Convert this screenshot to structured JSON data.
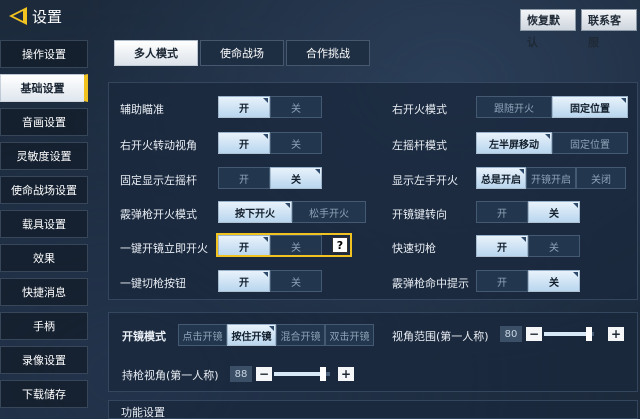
{
  "header": {
    "title": "设置",
    "restore_label": "恢复默认",
    "service_label": "联系客服"
  },
  "sidebar": {
    "items": [
      {
        "label": "操作设置"
      },
      {
        "label": "基础设置",
        "active": true
      },
      {
        "label": "音画设置"
      },
      {
        "label": "灵敏度设置"
      },
      {
        "label": "使命战场设置"
      },
      {
        "label": "载具设置"
      },
      {
        "label": "效果"
      },
      {
        "label": "快捷消息"
      },
      {
        "label": "手柄"
      },
      {
        "label": "录像设置"
      },
      {
        "label": "下载储存"
      }
    ]
  },
  "tabs": [
    {
      "label": "多人模式",
      "active": true
    },
    {
      "label": "使命战场"
    },
    {
      "label": "合作挑战"
    }
  ],
  "settings": {
    "aim_assist": {
      "label": "辅助瞄准",
      "options": [
        "开",
        "关"
      ],
      "selected": 0
    },
    "right_fire_turn": {
      "label": "右开火转动视角",
      "options": [
        "开",
        "关"
      ],
      "selected": 0
    },
    "fixed_left_stick": {
      "label": "固定显示左摇杆",
      "options": [
        "开",
        "关"
      ],
      "selected": 1
    },
    "shotgun_fire_mode": {
      "label": "霰弹枪开火模式",
      "options": [
        "按下开火",
        "松手开火"
      ],
      "selected": 0
    },
    "scope_fire": {
      "label": "一键开镜立即开火",
      "options": [
        "开",
        "关"
      ],
      "selected": 0,
      "help": "?"
    },
    "switch_gun_button": {
      "label": "一键切枪按钮",
      "options": [
        "开",
        "关"
      ],
      "selected": 0
    },
    "right_fire_mode": {
      "label": "右开火模式",
      "options": [
        "跟随开火",
        "固定位置"
      ],
      "selected": 1
    },
    "left_stick_mode": {
      "label": "左摇杆模式",
      "options": [
        "左半屏移动",
        "固定位置"
      ],
      "selected": 0
    },
    "left_fire_display": {
      "label": "显示左手开火",
      "options": [
        "总是开启",
        "开镜开启",
        "关闭"
      ],
      "selected": 0
    },
    "fire_key_turn": {
      "label": "开镜键转向",
      "options": [
        "开",
        "关"
      ],
      "selected": 1
    },
    "quick_switch": {
      "label": "快速切枪",
      "options": [
        "开",
        "关"
      ],
      "selected": 0
    },
    "shotgun_hit_hint": {
      "label": "霰弹枪命中提示",
      "options": [
        "开",
        "关"
      ],
      "selected": 1
    }
  },
  "scope": {
    "mode_label": "开镜模式",
    "mode_options": [
      "点击开镜",
      "按住开镜",
      "混合开镜",
      "双击开镜"
    ],
    "mode_selected": 1,
    "fov_label": "视角范围(第一人称)",
    "fov_value": "80",
    "fov_fraction": 0.9,
    "hold_fov_label": "持枪视角(第一人称)",
    "hold_fov_value": "88",
    "hold_fov_fraction": 0.88,
    "minus": "−",
    "plus": "+"
  },
  "function_section": {
    "title": "功能设置"
  },
  "colors": {
    "accent": "#f1c320",
    "selected_option": "#cfe4f4"
  },
  "icons": {
    "back": "back-arrow-icon"
  }
}
